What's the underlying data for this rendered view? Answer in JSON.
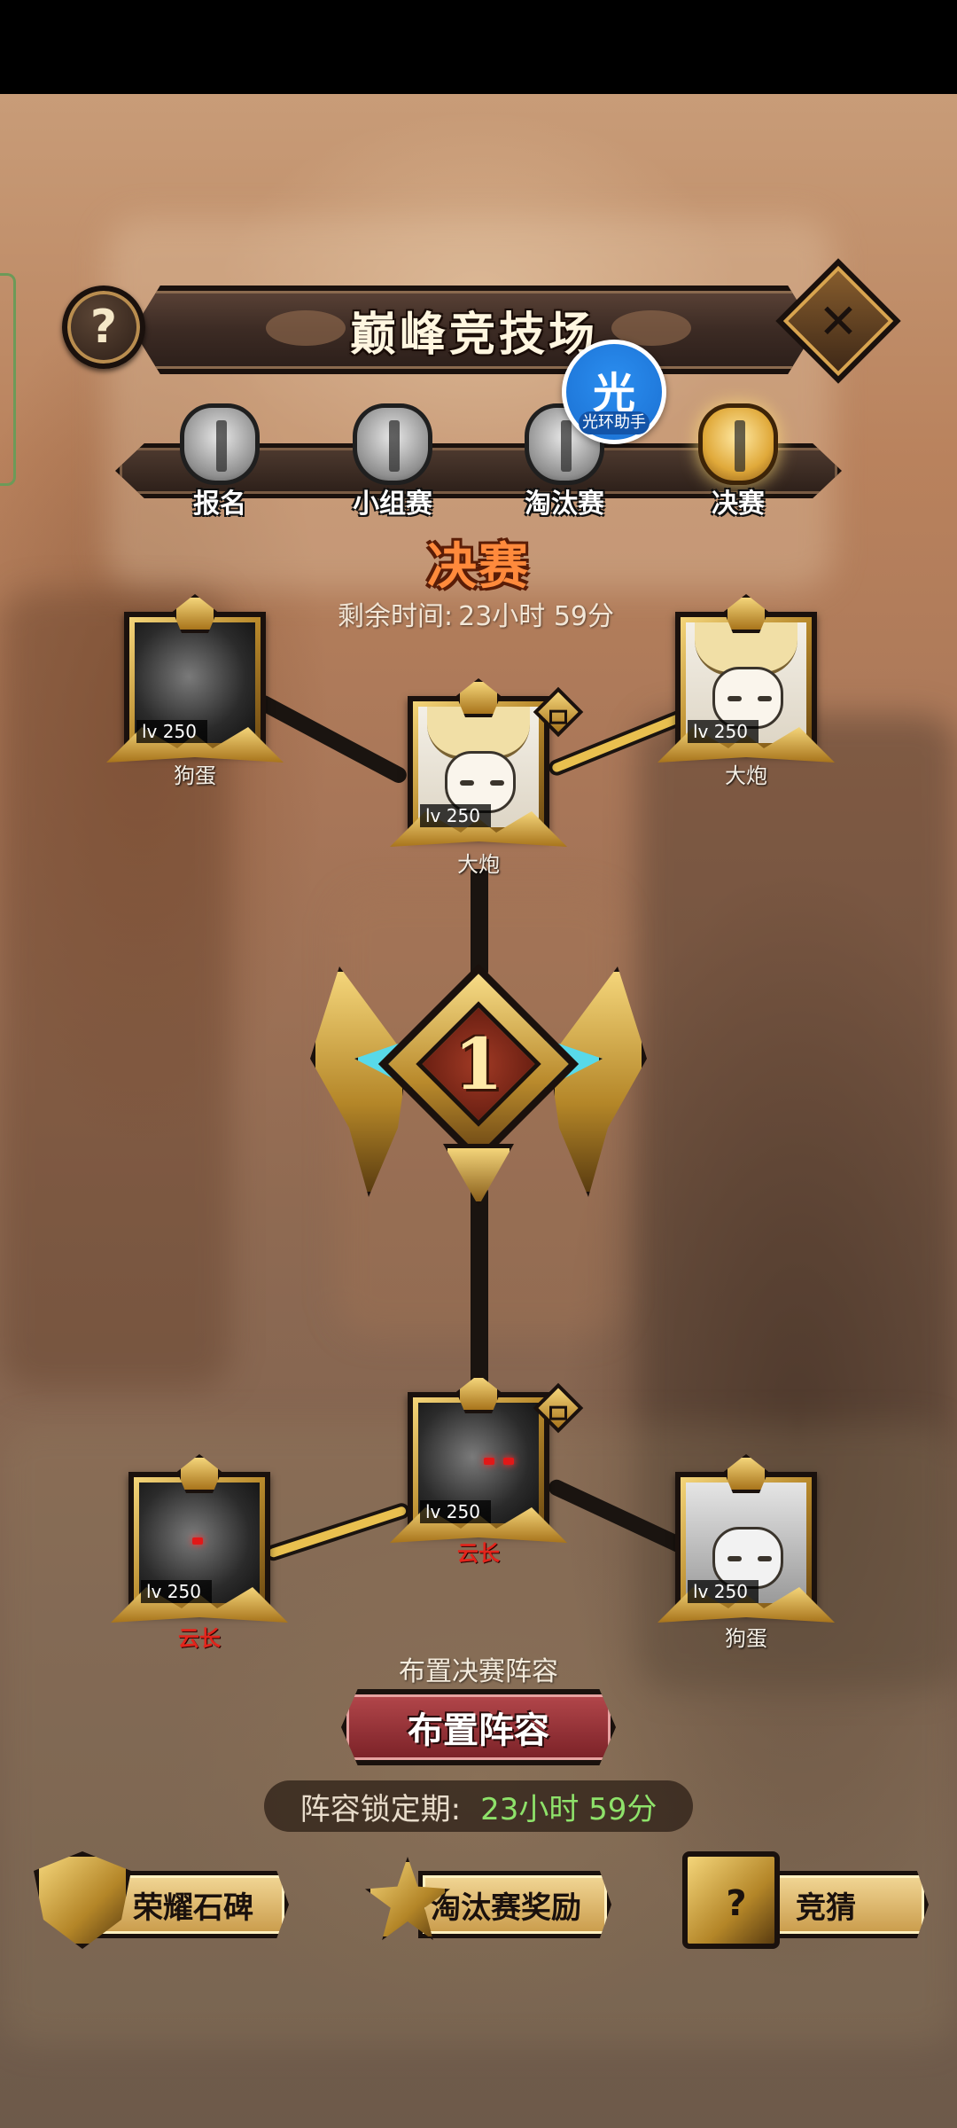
{
  "header": {
    "title": "巅峰竞技场",
    "help_glyph": "?",
    "close_glyph": "✕"
  },
  "stages": [
    {
      "label": "报名",
      "active": false
    },
    {
      "label": "小组赛",
      "active": false
    },
    {
      "label": "淘汰赛",
      "active": false
    },
    {
      "label": "决赛",
      "active": true
    }
  ],
  "overlay_badge": {
    "glyph": "光",
    "caption": "光环助手"
  },
  "final": {
    "title": "决赛",
    "remaining_label": "剩余时间:",
    "remaining_value": "23小时 59分"
  },
  "bracket": {
    "top_left": {
      "level": "lv 250",
      "name": "狗蛋"
    },
    "top_right": {
      "level": "lv 250",
      "name": "大炮"
    },
    "top_winner": {
      "level": "lv 250",
      "name": "大炮"
    },
    "bottom_winner": {
      "level": "lv 250",
      "name": "云长"
    },
    "bottom_left": {
      "level": "lv 250",
      "name": "云长"
    },
    "bottom_right": {
      "level": "lv 250",
      "name": "狗蛋"
    },
    "trophy_rank": "1"
  },
  "setup": {
    "hint": "布置决赛阵容",
    "button_label": "布置阵容",
    "lock_label": "阵容锁定期:",
    "lock_value": "23小时 59分"
  },
  "bottom_buttons": {
    "honor": "荣耀石碑",
    "knockout_reward": "淘汰赛奖励",
    "guess": "竞猜",
    "guess_glyph": "?"
  },
  "colors": {
    "final_title": "#ff8a3c",
    "lock_value": "#8ee26a",
    "winner_link": "#e9c04f",
    "red_name": "#e3241b"
  }
}
